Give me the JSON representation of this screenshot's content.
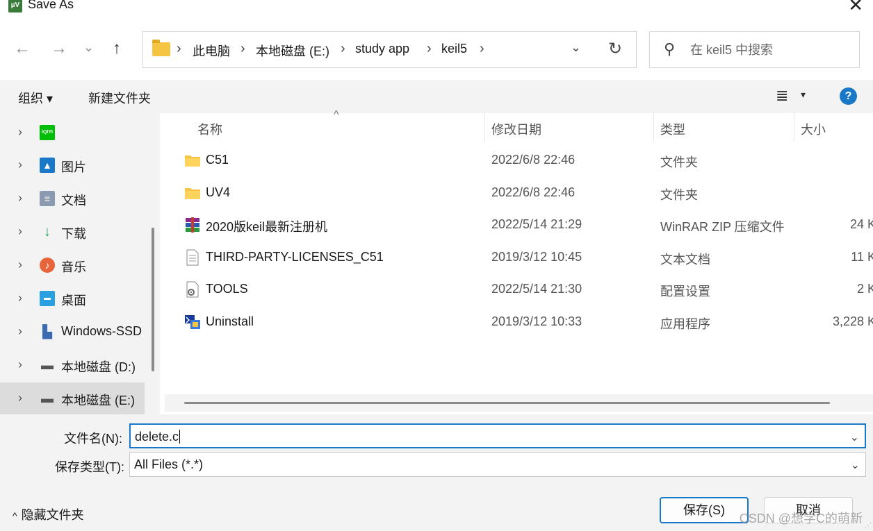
{
  "window": {
    "title": "Save As",
    "app_icon": "keil-uv5-icon",
    "close_glyph": "✕"
  },
  "nav": {
    "back_glyph": "←",
    "forward_glyph": "→",
    "recent_glyph": "⌄",
    "up_glyph": "↑",
    "breadcrumb": [
      "此电脑",
      "本地磁盘 (E:)",
      "study app",
      "keil5"
    ],
    "sep_glyph": "›",
    "dropdown_glyph": "⌄",
    "refresh_glyph": "↻",
    "search_glyph": "⚲",
    "search_placeholder": "在 keil5 中搜索"
  },
  "commands": {
    "organize": "组织 ▾",
    "new_folder": "新建文件夹",
    "view_glyph": "≣",
    "view_dd_glyph": "▾",
    "help_glyph": "?"
  },
  "sidebar": {
    "chevron_glyph": "›",
    "items": [
      {
        "label": "",
        "icon": "iqiyi-icon",
        "icon_text": "iQIYI",
        "icon_color": "#00be06"
      },
      {
        "label": "图片",
        "icon": "pictures-icon",
        "icon_text": "▲",
        "icon_color": "#1a78c8"
      },
      {
        "label": "文档",
        "icon": "documents-icon",
        "icon_text": "≡",
        "icon_color": "#8a9bb0"
      },
      {
        "label": "下载",
        "icon": "download-icon",
        "icon_text": "↓",
        "icon_color": "#1aa260"
      },
      {
        "label": "音乐",
        "icon": "music-icon",
        "icon_text": "♪",
        "icon_color": "#e8643a"
      },
      {
        "label": "桌面",
        "icon": "desktop-icon",
        "icon_text": "▬",
        "icon_color": "#2aa0e0"
      },
      {
        "label": "Windows-SSD",
        "icon": "windows-drive-icon",
        "icon_text": "▙",
        "icon_color": "#3a6ab0"
      },
      {
        "label": "本地磁盘 (D:)",
        "icon": "drive-d-icon",
        "icon_text": "▬",
        "icon_color": "#555555"
      },
      {
        "label": "本地磁盘 (E:)",
        "icon": "drive-e-icon",
        "icon_text": "▬",
        "icon_color": "#555555"
      }
    ]
  },
  "file_list": {
    "columns": {
      "name": "名称",
      "modified": "修改日期",
      "type": "类型",
      "size": "大小"
    },
    "sort_glyph": "^",
    "rows": [
      {
        "name": "C51",
        "modified": "2022/6/8 22:46",
        "type": "文件夹",
        "size": "",
        "icon": "folder-icon"
      },
      {
        "name": "UV4",
        "modified": "2022/6/8 22:46",
        "type": "文件夹",
        "size": "",
        "icon": "folder-icon"
      },
      {
        "name": "2020版keil最新注册机",
        "modified": "2022/5/14 21:29",
        "type": "WinRAR ZIP 压缩文件",
        "size": "24 K",
        "icon": "winrar-archive-icon"
      },
      {
        "name": "THIRD-PARTY-LICENSES_C51",
        "modified": "2019/3/12 10:45",
        "type": "文本文档",
        "size": "11 K",
        "icon": "text-document-icon"
      },
      {
        "name": "TOOLS",
        "modified": "2022/5/14 21:30",
        "type": "配置设置",
        "size": "2 K",
        "icon": "config-settings-icon"
      },
      {
        "name": "Uninstall",
        "modified": "2019/3/12 10:33",
        "type": "应用程序",
        "size": "3,228 K",
        "icon": "application-icon"
      }
    ]
  },
  "form": {
    "filename_label": "文件名(N):",
    "filename_value": "delete.c",
    "filetype_label": "保存类型(T):",
    "filetype_value": "All Files (*.*)",
    "dd_glyph": "⌄"
  },
  "footer": {
    "hide_folders": "隐藏文件夹",
    "hide_glyph": "^",
    "save": "保存(S)",
    "cancel": "取消",
    "watermark": "CSDN @想学C的萌新"
  },
  "colors": {
    "accent": "#1a78c8",
    "pane_bg": "#f3f3f3",
    "folder": "#f5c542"
  }
}
